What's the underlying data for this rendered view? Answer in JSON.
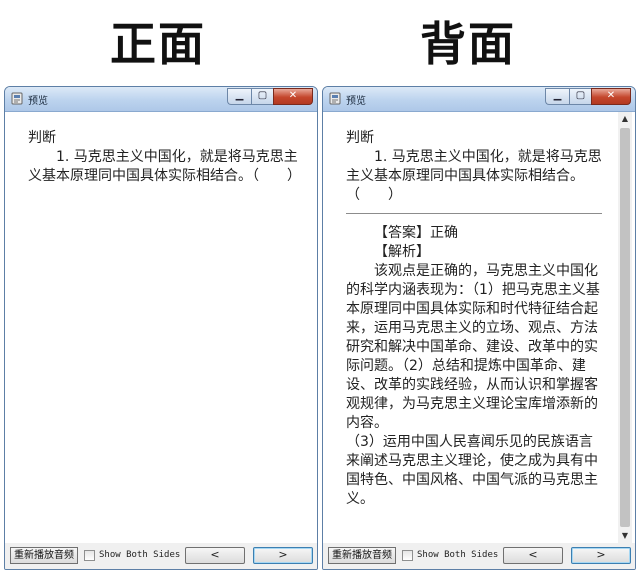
{
  "headings": {
    "front": "正面",
    "back": "背面"
  },
  "window": {
    "title": "预览",
    "minimize": "▁",
    "maximize": "▢",
    "close": "✕"
  },
  "question": {
    "type": "判断",
    "line": "1. 马克思主义中国化，就是将马克思主义基本原理同中国具体实际相结合。（　　）"
  },
  "answer": {
    "answer_line": "【答案】正确",
    "analysis_label": "【解析】",
    "analysis_p1": "该观点是正确的，马克思主义中国化的科学内涵表现为：（1）把马克思主义基本原理同中国具体实际和时代特征结合起来，运用马克思主义的立场、观点、方法研究和解决中国革命、建设、改革中的实际问题。（2）总结和提炼中国革命、建设、改革的实践经验，从而认识和掌握客观规律，为马克思主义理论宝库增添新的内容。",
    "analysis_p2": "（3）运用中国人民喜闻乐见的民族语言来阐述马克思主义理论，使之成为具有中国特色、中国风格、中国气派的马克思主义。"
  },
  "bottom": {
    "replay_label": "重新播放音频",
    "show_both_sides": "Show Both Sides",
    "prev": "<",
    "next": ">"
  },
  "colors": {
    "titlebar": "#bcd3ee",
    "close_button": "#c4462c",
    "scroll_thumb": "#c2c2c2"
  }
}
